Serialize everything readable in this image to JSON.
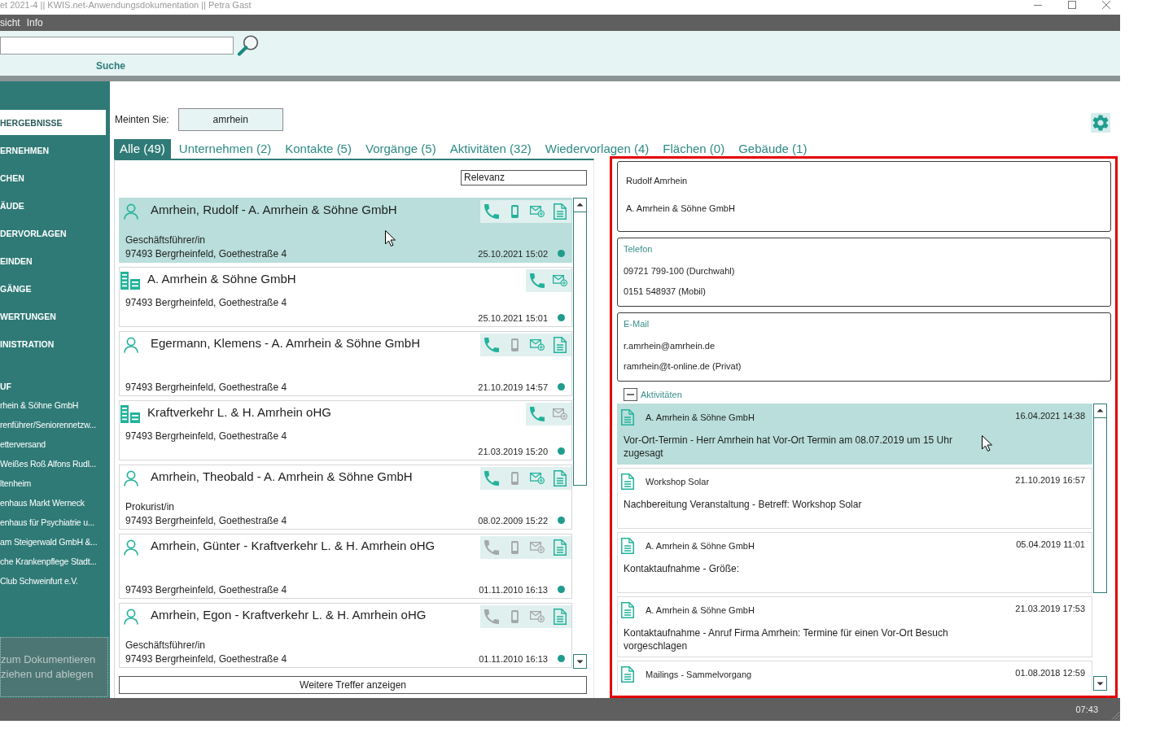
{
  "window": {
    "title": "et 2021-4 || KWIS.net-Anwendungsdokumentation || Petra Gast"
  },
  "menu": [
    {
      "label": "sicht"
    },
    {
      "label": "Info"
    }
  ],
  "search": {
    "label": "Suche"
  },
  "sidebar": {
    "items": [
      {
        "label": "HERGEBNISSE",
        "selected": true
      },
      {
        "label": "ERNEHMEN",
        "selected": false
      },
      {
        "label": "CHEN",
        "selected": false
      },
      {
        "label": "ÄUDE",
        "selected": false
      },
      {
        "label": "DERVORLAGEN",
        "selected": false
      },
      {
        "label": "EINDEN",
        "selected": false
      },
      {
        "label": "GÄNGE",
        "selected": false
      },
      {
        "label": "WERTUNGEN",
        "selected": false
      },
      {
        "label": "INISTRATION",
        "selected": false
      }
    ],
    "history_title": "UF",
    "history": [
      "rhein & Söhne GmbH",
      "renführer/Seniorennetzw...",
      "etterversand",
      "Weißes Roß Alfons Rudl...",
      "ltenheim",
      "enhaus Markt Werneck",
      "enhaus für Psychiatrie u...",
      "am Steigerwald GmbH &...",
      "che Krankenpflege Stadt...",
      "Club Schweinfurt e.V."
    ],
    "dropzone": "zum Dokumentieren ziehen und ablegen"
  },
  "suggestion": {
    "label": "Meinten Sie:",
    "value": "amrhein"
  },
  "tabs": [
    {
      "label": "Alle (49)",
      "selected": true
    },
    {
      "label": "Unternehmen (2)",
      "selected": false
    },
    {
      "label": "Kontakte (5)",
      "selected": false
    },
    {
      "label": "Vorgänge (5)",
      "selected": false
    },
    {
      "label": "Aktivitäten (32)",
      "selected": false
    },
    {
      "label": "Wiedervorlagen (4)",
      "selected": false
    },
    {
      "label": "Flächen (0)",
      "selected": false
    },
    {
      "label": "Gebäude (1)",
      "selected": false
    }
  ],
  "results": {
    "sort": "Relevanz",
    "items": [
      {
        "kind": "person",
        "title": "Amrhein, Rudolf - A. Amrhein & Söhne GmbH",
        "role": "Geschäftsführer/in",
        "address": "97493 Bergrheinfeld, Goethestraße 4",
        "date": "25.10.2021 15:02",
        "selected": true,
        "actions": [
          {
            "kind": "phone",
            "enabled": true
          },
          {
            "kind": "mobile",
            "enabled": true
          },
          {
            "kind": "email",
            "enabled": true
          },
          {
            "kind": "document",
            "enabled": true
          }
        ]
      },
      {
        "kind": "company",
        "title": "A. Amrhein & Söhne GmbH",
        "address": "97493 Bergrheinfeld, Goethestraße 4",
        "date": "25.10.2021 15:01",
        "selected": false,
        "actions": [
          {
            "kind": "phone",
            "enabled": true
          },
          {
            "kind": "email",
            "enabled": true
          }
        ]
      },
      {
        "kind": "person",
        "title": "Egermann, Klemens - A. Amrhein & Söhne GmbH",
        "address": "97493 Bergrheinfeld, Goethestraße 4",
        "date": "21.10.2019 14:57",
        "selected": false,
        "actions": [
          {
            "kind": "phone",
            "enabled": true
          },
          {
            "kind": "mobile",
            "enabled": false
          },
          {
            "kind": "email",
            "enabled": true
          },
          {
            "kind": "document",
            "enabled": true
          }
        ]
      },
      {
        "kind": "company",
        "title": "Kraftverkehr L. & H. Amrhein oHG",
        "address": "97493 Bergrheinfeld, Goethestraße 4",
        "date": "21.03.2019 15:20",
        "selected": false,
        "actions": [
          {
            "kind": "phone",
            "enabled": true
          },
          {
            "kind": "email",
            "enabled": false
          }
        ]
      },
      {
        "kind": "person",
        "title": "Amrhein, Theobald - A. Amrhein & Söhne GmbH",
        "role": "Prokurist/in",
        "address": "97493 Bergrheinfeld, Goethestraße 4",
        "date": "08.02.2009 15:22",
        "selected": false,
        "actions": [
          {
            "kind": "phone",
            "enabled": true
          },
          {
            "kind": "mobile",
            "enabled": false
          },
          {
            "kind": "email",
            "enabled": true
          },
          {
            "kind": "document",
            "enabled": true
          }
        ]
      },
      {
        "kind": "person",
        "title": "Amrhein, Günter - Kraftverkehr L. & H. Amrhein oHG",
        "address": "97493 Bergrheinfeld, Goethestraße 4",
        "date": "01.11.2010 16:13",
        "selected": false,
        "actions": [
          {
            "kind": "phone",
            "enabled": false
          },
          {
            "kind": "mobile",
            "enabled": false
          },
          {
            "kind": "email",
            "enabled": false
          },
          {
            "kind": "document",
            "enabled": true
          }
        ]
      },
      {
        "kind": "person",
        "title": "Amrhein, Egon - Kraftverkehr L. & H. Amrhein oHG",
        "role": "Geschäftsführer/in",
        "address": "97493 Bergrheinfeld, Goethestraße 4",
        "date": "01.11.2010 16:13",
        "selected": false,
        "actions": [
          {
            "kind": "phone",
            "enabled": false
          },
          {
            "kind": "mobile",
            "enabled": false
          },
          {
            "kind": "email",
            "enabled": false
          },
          {
            "kind": "document",
            "enabled": true
          }
        ]
      }
    ],
    "more_button": "Weitere Treffer anzeigen"
  },
  "detail": {
    "name": "Rudolf Amrhein",
    "company": "A. Amrhein & Söhne GmbH",
    "sections": [
      {
        "title": "Telefon",
        "values": [
          "09721 799-100 (Durchwahl)",
          "0151 548937 (Mobil)"
        ]
      },
      {
        "title": "E-Mail",
        "values": [
          "r.amrhein@amrhein.de",
          "ramrhein@t-online.de (Privat)"
        ]
      }
    ],
    "activities": {
      "title": "Aktivitäten",
      "expanded": true,
      "items": [
        {
          "title": "A. Amrhein & Söhne GmbH",
          "date": "16.04.2021 14:38",
          "body": "Vor-Ort-Termin - Herr Amrhein hat Vor-Ort Termin am 08.07.2019 um 15 Uhr zugesagt",
          "selected": true
        },
        {
          "title": "Workshop Solar",
          "date": "21.10.2019 16:57",
          "body": "Nachbereitung Veranstaltung - Betreff: Workshop Solar",
          "selected": false
        },
        {
          "title": "A. Amrhein & Söhne GmbH",
          "date": "05.04.2019 11:01",
          "body": "Kontaktaufnahme - Größe:",
          "selected": false
        },
        {
          "title": "A. Amrhein & Söhne GmbH",
          "date": "21.03.2019 17:53",
          "body": "Kontaktaufnahme - Anruf Firma Amrhein: Termine für einen Vor-Ort Besuch vorgeschlagen",
          "selected": false
        },
        {
          "title": "Mailings - Sammelvorgang",
          "date": "01.08.2018 12:59",
          "selected": false
        }
      ]
    }
  },
  "status_bar": {
    "time": "07:43"
  }
}
